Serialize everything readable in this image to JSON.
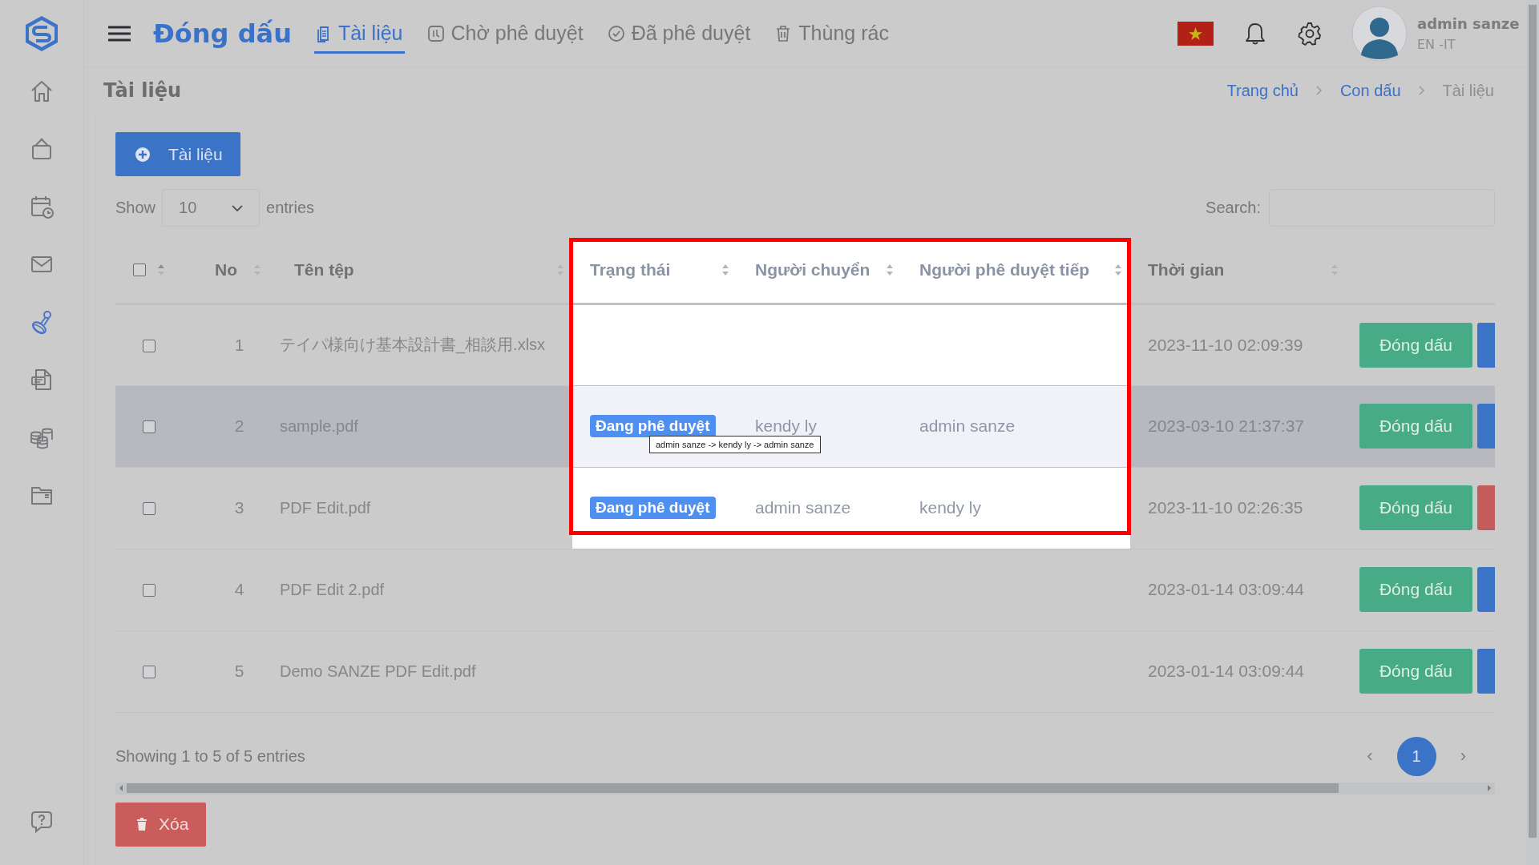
{
  "app": {
    "title": "Đóng dấu"
  },
  "tabs": [
    {
      "label": "Tài liệu",
      "selected": true
    },
    {
      "label": "Chờ phê duyệt",
      "selected": false
    },
    {
      "label": "Đã phê duyệt",
      "selected": false
    },
    {
      "label": "Thùng rác",
      "selected": false
    }
  ],
  "user": {
    "name": "admin sanze",
    "role": "EN -IT"
  },
  "sidebar": [
    {
      "selected": false
    },
    {
      "selected": false
    },
    {
      "selected": false
    },
    {
      "selected": false
    },
    {
      "selected": true
    },
    {
      "selected": false
    },
    {
      "selected": false
    },
    {
      "selected": false
    }
  ],
  "page_title": "Tài liệu",
  "breadcrumbs": [
    {
      "label": "Trang chủ",
      "link": true
    },
    {
      "label": "Con dấu",
      "link": true
    },
    {
      "label": "Tài liệu",
      "link": false
    }
  ],
  "add_button": "Tài liệu",
  "length": {
    "before": "Show",
    "value": "10",
    "after": "entries"
  },
  "search": {
    "label": "Search:"
  },
  "table": {
    "header_highlighted": true,
    "header_checked": false,
    "columns": [
      "No",
      "Tên tệp",
      "Trạng thái",
      "Người chuyển",
      "Người phê duyệt tiếp",
      "Thời gian"
    ],
    "rows": [
      {
        "checked": false,
        "no": "1",
        "file": "テイパ様向け基本設計書_相談用.xlsx",
        "time": "2023-11-10 02:09:39",
        "action": "Đóng dấu",
        "side_button": {
          "color": "#3b73c7"
        },
        "highlighted": true,
        "hovered": false
      },
      {
        "checked": false,
        "no": "2",
        "file": "sample.pdf",
        "status": "Đang phê duyệt",
        "tooltip": "admin sanze -> kendy ly -> admin sanze",
        "sender": "kendy ly",
        "next_approver": "admin sanze",
        "time": "2023-03-10 21:37:37",
        "action": "Đóng dấu",
        "side_button": {
          "color": "#3b73c7"
        },
        "highlighted": true,
        "hovered": true
      },
      {
        "checked": false,
        "no": "3",
        "file": "PDF Edit.pdf",
        "status": "Đang phê duyệt",
        "sender": "admin sanze",
        "next_approver": "kendy ly",
        "time": "2023-11-10 02:26:35",
        "action": "Đóng dấu",
        "side_button": {
          "color": "#c55c5c"
        },
        "highlighted": true,
        "hovered": false
      },
      {
        "checked": false,
        "no": "4",
        "file": "PDF Edit 2.pdf",
        "time": "2023-01-14 03:09:44",
        "action": "Đóng dấu",
        "side_button": {
          "color": "#3b73c7"
        },
        "highlighted": false,
        "hovered": false
      },
      {
        "checked": false,
        "no": "5",
        "file": "Demo SANZE PDF Edit.pdf",
        "time": "2023-01-14 03:09:44",
        "action": "Đóng dấu",
        "side_button": {
          "color": "#3b73c7"
        },
        "highlighted": false,
        "hovered": false
      }
    ]
  },
  "info": "Showing 1 to 5 of 5 entries",
  "pagination": {
    "prev": "‹",
    "pages": [
      {
        "label": "1",
        "selected": true
      }
    ],
    "next": "›"
  },
  "delete_button": "Xóa"
}
